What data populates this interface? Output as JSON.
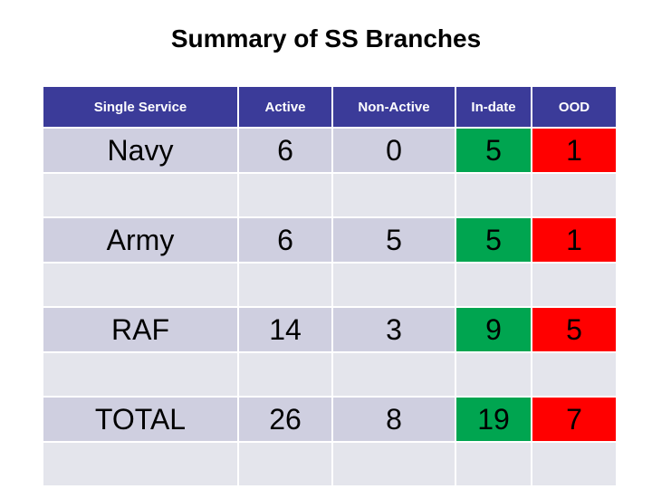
{
  "title": "Summary of SS Branches",
  "table": {
    "columns": [
      {
        "key": "name",
        "label": "Single Service"
      },
      {
        "key": "active",
        "label": "Active"
      },
      {
        "key": "non",
        "label": "Non-Active"
      },
      {
        "key": "indate",
        "label": "In-date"
      },
      {
        "key": "ood",
        "label": "OOD"
      }
    ],
    "rows": [
      {
        "name": "Navy",
        "active": "6",
        "non": "0",
        "indate": "5",
        "ood": "1"
      },
      {
        "name": "Army",
        "active": "6",
        "non": "5",
        "indate": "5",
        "ood": "1"
      },
      {
        "name": "RAF",
        "active": "14",
        "non": "3",
        "indate": "9",
        "ood": "5"
      },
      {
        "name": "TOTAL",
        "active": "26",
        "non": "8",
        "indate": "19",
        "ood": "7"
      }
    ]
  },
  "colors": {
    "header_background": "#3B3B99",
    "header_text": "#FFFFFF",
    "data_background": "#CFCFE0",
    "spacer_background": "#E4E5EC",
    "indate_background": "#00A550",
    "ood_background": "#FF0000",
    "title_text": "#000000"
  }
}
